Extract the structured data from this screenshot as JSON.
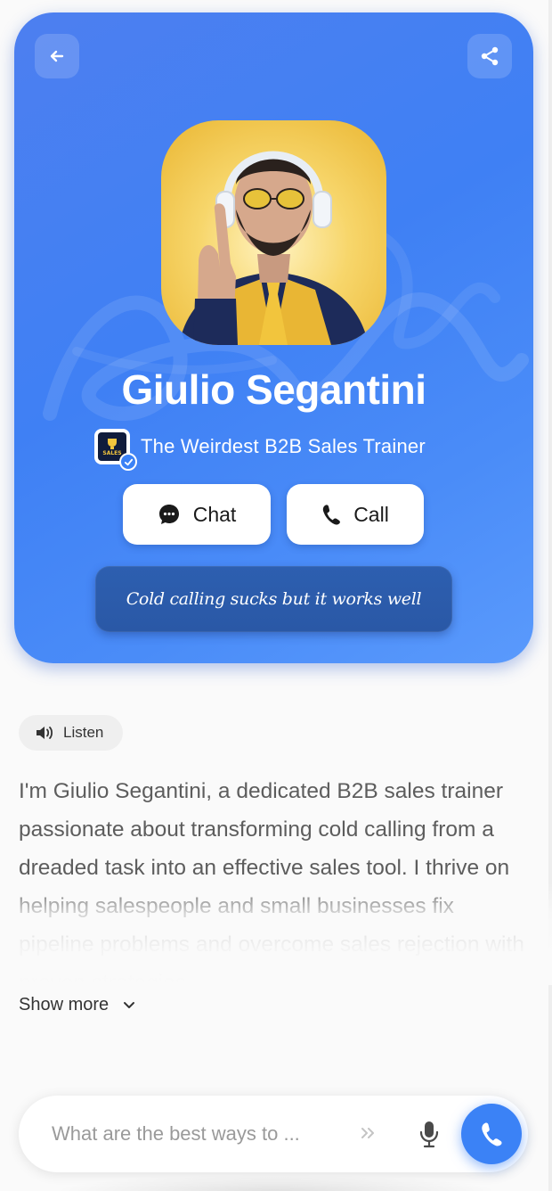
{
  "profile": {
    "name": "Giulio Segantini",
    "subtitle": "The Weirdest B2B Sales Trainer",
    "badge_text": "SALES",
    "tagline": "Cold calling sucks but it works well"
  },
  "actions": {
    "chat_label": "Chat",
    "call_label": "Call"
  },
  "listen": {
    "label": "Listen"
  },
  "bio": {
    "text": "I'm Giulio Segantini, a dedicated B2B sales trainer passionate about transforming cold calling from a dreaded task into an effective sales tool. I thrive on helping salespeople and small businesses fix pipeline problems and overcome sales rejection with proven strategies."
  },
  "show_more": {
    "label": "Show more"
  },
  "composer": {
    "placeholder": "What are the best ways to ..."
  },
  "icons": {
    "back": "arrow-left-icon",
    "share": "share-icon",
    "chat": "chat-bubble-icon",
    "call": "phone-icon",
    "speaker": "speaker-icon",
    "chevron": "chevron-down-icon",
    "send": "double-chevron-icon",
    "mic": "microphone-icon",
    "verified": "checkmark-icon"
  },
  "colors": {
    "accent": "#3b82f6",
    "hero_top": "#4d7ff0",
    "hero_bottom": "#5a9afc",
    "avatar_bg": "#f7d66b"
  }
}
